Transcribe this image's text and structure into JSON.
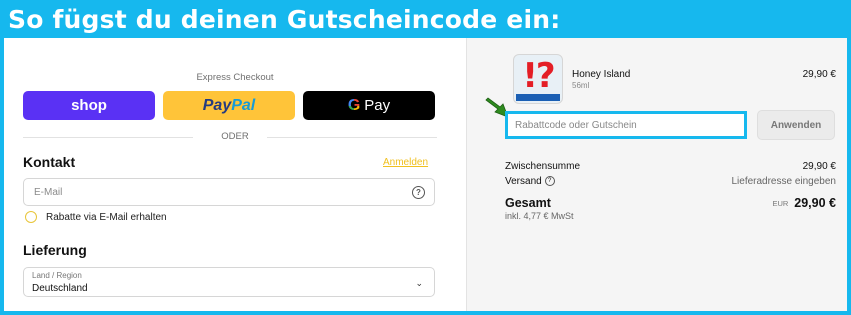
{
  "banner": {
    "title": "So fügst du deinen Gutscheincode ein:"
  },
  "checkout": {
    "express_title": "Express Checkout",
    "shop_label": "shop",
    "paypal_label_a": "Pay",
    "paypal_label_b": "Pal",
    "gpay_g": "G",
    "gpay_label": "Pay",
    "divider": "ODER",
    "contact_heading": "Kontakt",
    "login_link": "Anmelden",
    "email_placeholder": "E-Mail",
    "help_icon": "?",
    "newsletter_label": "Rabatte via E-Mail erhalten",
    "delivery_heading": "Lieferung",
    "region_label": "Land / Region",
    "region_value": "Deutschland",
    "region_chevron": "⌄"
  },
  "summary": {
    "product": {
      "name": "Honey Island",
      "variant": "56ml",
      "price": "29,90 €",
      "thumb_symbol": "!?"
    },
    "coupon_placeholder": "Rabattcode oder Gutschein",
    "apply_label": "Anwenden",
    "subtotal_label": "Zwischensumme",
    "subtotal_value": "29,90 €",
    "shipping_label": "Versand",
    "shipping_value": "Lieferadresse eingeben",
    "total_label": "Gesamt",
    "total_currency": "EUR",
    "total_value": "29,90 €",
    "tax_note": "inkl. 4,77 € MwSt"
  },
  "colors": {
    "accent_border": "#16b8ee",
    "arrow": "#2e8b1f",
    "shop": "#5a31f4",
    "paypal": "#ffc439"
  },
  "icons": [
    "help-icon",
    "chevron-down-icon",
    "arrow-pointer-icon"
  ]
}
